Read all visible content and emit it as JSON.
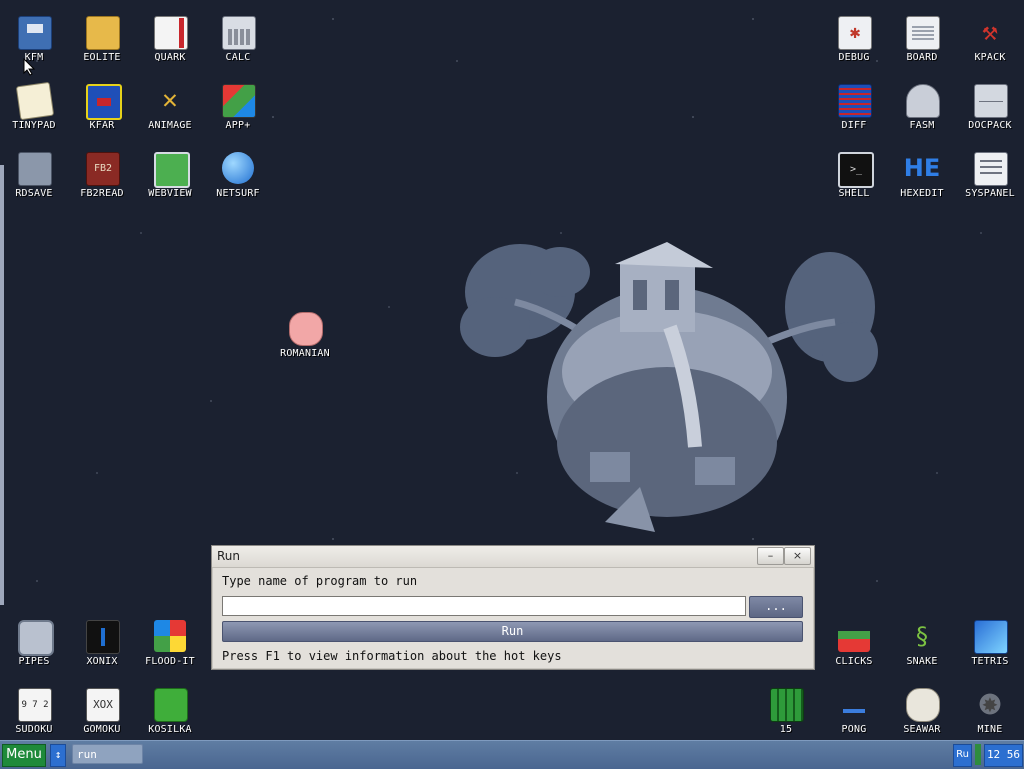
{
  "desktop": {
    "icons": [
      {
        "label": "KFM",
        "icon": "floppy-disk-icon"
      },
      {
        "label": "EOLITE",
        "icon": "folder-icon"
      },
      {
        "label": "QUARK",
        "icon": "notebook-icon"
      },
      {
        "label": "CALC",
        "icon": "calculator-icon"
      },
      {
        "label": "TINYPAD",
        "icon": "notepad-icon"
      },
      {
        "label": "KFAR",
        "icon": "file-manager-icon"
      },
      {
        "label": "ANIMAGE",
        "icon": "paint-tools-icon"
      },
      {
        "label": "APP+",
        "icon": "cube-icon"
      },
      {
        "label": "RDSAVE",
        "icon": "ramdisk-save-icon"
      },
      {
        "label": "FB2READ",
        "icon": "book-icon"
      },
      {
        "label": "WEBVIEW",
        "icon": "browser-icon"
      },
      {
        "label": "NETSURF",
        "icon": "globe-icon"
      },
      {
        "label": "DEBUG",
        "icon": "bug-icon"
      },
      {
        "label": "BOARD",
        "icon": "board-icon"
      },
      {
        "label": "KPACK",
        "icon": "hammer-icon"
      },
      {
        "label": "DIFF",
        "icon": "diff-icon"
      },
      {
        "label": "FASM",
        "icon": "assembler-icon"
      },
      {
        "label": "DOCPACK",
        "icon": "cabinet-icon"
      },
      {
        "label": "SHELL",
        "icon": "terminal-icon"
      },
      {
        "label": "HEXEDIT",
        "icon": "hex-icon"
      },
      {
        "label": "SYSPANEL",
        "icon": "sliders-icon"
      },
      {
        "label": "ROMANIAN",
        "icon": "pig-icon"
      },
      {
        "label": "PIPES",
        "icon": "pipes-icon"
      },
      {
        "label": "XONIX",
        "icon": "xonix-icon"
      },
      {
        "label": "FLOOD-IT",
        "icon": "color-grid-icon"
      },
      {
        "label": "SUDOKU",
        "icon": "sudoku-icon"
      },
      {
        "label": "GOMOKU",
        "icon": "gomoku-icon"
      },
      {
        "label": "KOSILKA",
        "icon": "lawnmower-icon"
      },
      {
        "label": "15",
        "icon": "fifteen-puzzle-icon"
      },
      {
        "label": "CLICKS",
        "icon": "blocks-icon"
      },
      {
        "label": "SNAKE",
        "icon": "snake-icon"
      },
      {
        "label": "TETRIS",
        "icon": "tetris-icon"
      },
      {
        "label": "PONG",
        "icon": "pong-icon"
      },
      {
        "label": "SEAWAR",
        "icon": "seawar-icon"
      },
      {
        "label": "MINE",
        "icon": "mine-icon"
      }
    ]
  },
  "run_dialog": {
    "title": "Run",
    "minimize_label": "–",
    "close_label": "×",
    "prompt": "Type name of program to run",
    "input_value": "",
    "browse_label": "...",
    "run_label": "Run",
    "hint": "Press F1 to view information about the hot keys"
  },
  "taskbar": {
    "menu_label": "Menu",
    "switch_label": "↕",
    "task_label": "run",
    "language": "Ru",
    "clock": "12 56"
  },
  "colors": {
    "desktop_bg": "#1b2130",
    "taskbar": "#5572a0",
    "menu_button": "#1e8a3a",
    "accent_blue": "#2c6fd0"
  }
}
